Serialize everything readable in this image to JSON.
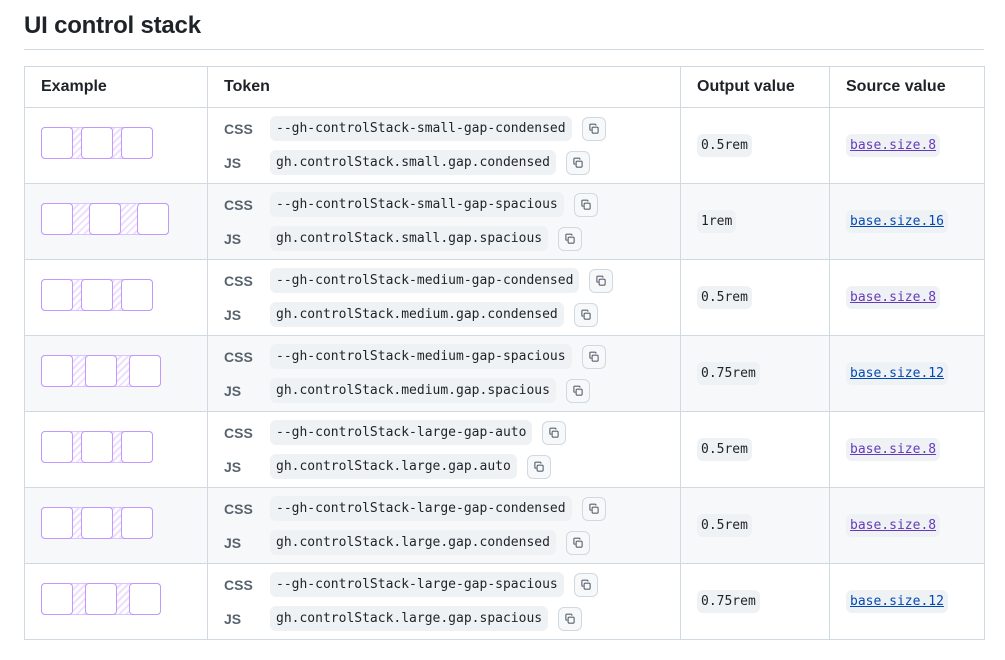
{
  "page": {
    "title": "UI control stack"
  },
  "table": {
    "headers": {
      "example": "Example",
      "token": "Token",
      "output": "Output value",
      "source": "Source value"
    },
    "css_label": "CSS",
    "js_label": "JS",
    "rows": [
      {
        "css": "--gh-controlStack-small-gap-condensed",
        "js": "gh.controlStack.small.gap.condensed",
        "output": "0.5rem",
        "source": "base.size.8"
      },
      {
        "css": "--gh-controlStack-small-gap-spacious",
        "js": "gh.controlStack.small.gap.spacious",
        "output": "1rem",
        "source": "base.size.16"
      },
      {
        "css": "--gh-controlStack-medium-gap-condensed",
        "js": "gh.controlStack.medium.gap.condensed",
        "output": "0.5rem",
        "source": "base.size.8"
      },
      {
        "css": "--gh-controlStack-medium-gap-spacious",
        "js": "gh.controlStack.medium.gap.spacious",
        "output": "0.75rem",
        "source": "base.size.12"
      },
      {
        "css": "--gh-controlStack-large-gap-auto",
        "js": "gh.controlStack.large.gap.auto",
        "output": "0.5rem",
        "source": "base.size.8"
      },
      {
        "css": "--gh-controlStack-large-gap-condensed",
        "js": "gh.controlStack.large.gap.condensed",
        "output": "0.5rem",
        "source": "base.size.8"
      },
      {
        "css": "--gh-controlStack-large-gap-spacious",
        "js": "gh.controlStack.large.gap.spacious",
        "output": "0.75rem",
        "source": "base.size.12"
      }
    ]
  },
  "colors": {
    "accent_purple": "#c297ff",
    "link_blue": "#0349b4",
    "link_visited": "#6639ba",
    "border": "#d1d9e0",
    "stripe": "#f6f8fa"
  },
  "icons": {
    "copy": "copy-icon"
  }
}
